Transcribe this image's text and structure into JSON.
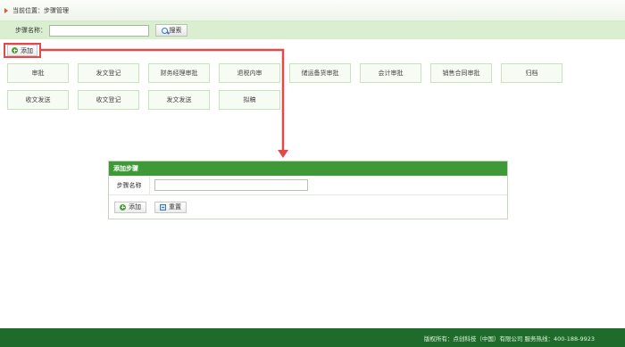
{
  "breadcrumb": {
    "text": "当前位置：步骤管理"
  },
  "search": {
    "label": "步骤名称：",
    "value": "",
    "placeholder": "",
    "button_label": "搜索"
  },
  "toolbar": {
    "add_label": "添加"
  },
  "steps": [
    "审批",
    "发文登记",
    "财务经理审批",
    "退税内审",
    "储运备货审批",
    "会计审批",
    "销售合同审批",
    "归档",
    "收文发送",
    "收文登记",
    "发文发送",
    "拟稿"
  ],
  "dialog": {
    "title": "添加步骤",
    "field_label": "步骤名称",
    "field_value": "",
    "add_label": "添加",
    "reset_label": "重置"
  },
  "footer": {
    "text": "版权所有：点创科技（中国）有限公司  服务热线：400-188-9923"
  },
  "colors": {
    "accent_green": "#3e9a36",
    "footer_green": "#1f6b2b",
    "highlight_red": "#e04a4a"
  }
}
